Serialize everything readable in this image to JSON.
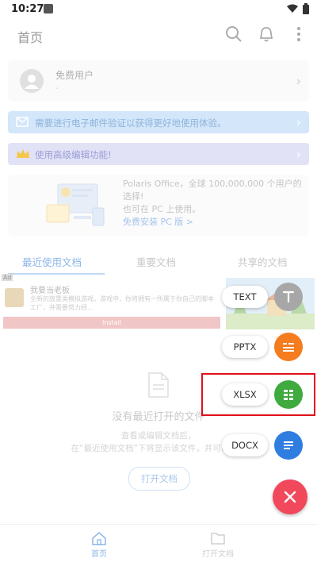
{
  "status_bar": {
    "time": "10:27"
  },
  "header": {
    "title": "首页"
  },
  "user_card": {
    "name": "免费用户",
    "sub": "-"
  },
  "banners": [
    {
      "text": "需要进行电子邮件验证以获得更好地使用体验。"
    },
    {
      "text": "使用高级编辑功能!"
    }
  ],
  "promo": {
    "line1": "Polaris Office，全球 100,000,000 个用户的选择!",
    "line2": "也可在 PC 上使用。",
    "link": "免费安装 PC 版 >"
  },
  "tabs": [
    {
      "label": "最近使用文档"
    },
    {
      "label": "重要文档"
    },
    {
      "label": "共享的文档"
    }
  ],
  "ad": {
    "label": "Ad",
    "title": "我要当老板",
    "desc": "全新的放置类模拟游戏，游戏中，你将拥有一所属于你自己的脚本工厂，并需要努力经...",
    "install": "Install"
  },
  "empty": {
    "title": "没有最近打开的文件",
    "desc_line1": "查看或编辑文档后，",
    "desc_line2": "在“最近使用文档”下将显示该文件，并可以轻松"
  },
  "open_button": "打开文档",
  "bottom_nav": [
    {
      "label": "首页"
    },
    {
      "label": "打开文档"
    }
  ],
  "fab_menu": {
    "text_label": "TEXT",
    "pptx_label": "PPTX",
    "xlsx_label": "XLSX",
    "docx_label": "DOCX"
  },
  "colors": {
    "text_fab": "#a7a7a7",
    "pptx_fab": "#f57c1f",
    "xlsx_fab": "#3faa3e",
    "docx_fab": "#2f7de1",
    "close_fab": "#f1485b",
    "highlight": "#e0111b"
  }
}
